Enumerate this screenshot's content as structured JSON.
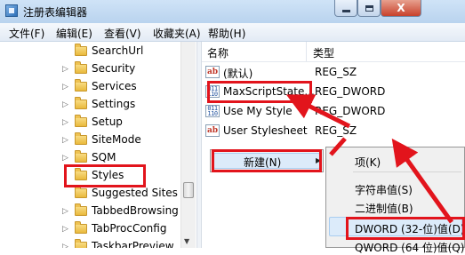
{
  "window": {
    "title": "注册表编辑器",
    "buttons": {
      "minimize": "minimize",
      "maximize": "maximize",
      "close": "X"
    }
  },
  "menu": {
    "file": "文件(F)",
    "edit": "编辑(E)",
    "view": "查看(V)",
    "favorites": "收藏夹(A)",
    "help": "帮助(H)"
  },
  "tree": {
    "items": [
      {
        "label": "SearchUrl",
        "has_children": false
      },
      {
        "label": "Security",
        "has_children": true
      },
      {
        "label": "Services",
        "has_children": true
      },
      {
        "label": "Settings",
        "has_children": true
      },
      {
        "label": "Setup",
        "has_children": true
      },
      {
        "label": "SiteMode",
        "has_children": true
      },
      {
        "label": "SQM",
        "has_children": true
      },
      {
        "label": "Styles",
        "has_children": false,
        "highlighted": true
      },
      {
        "label": "Suggested Sites",
        "has_children": false
      },
      {
        "label": "TabbedBrowsing",
        "has_children": true
      },
      {
        "label": "TabProcConfig",
        "has_children": true
      },
      {
        "label": "TaskbarPreview",
        "has_children": true
      }
    ],
    "expander_glyph": "▷"
  },
  "values": {
    "headers": {
      "name": "名称",
      "type": "类型"
    },
    "rows": [
      {
        "name": "(默认)",
        "type": "REG_SZ",
        "icon": "string-value-icon"
      },
      {
        "name": "MaxScriptState...",
        "type": "REG_DWORD",
        "icon": "dword-value-icon",
        "highlighted": true
      },
      {
        "name": "Use My Style",
        "type": "REG_DWORD",
        "icon": "dword-value-icon"
      },
      {
        "name": "User Stylesheet",
        "type": "REG_SZ",
        "icon": "string-value-icon"
      }
    ],
    "icon_text": {
      "sz": "ab",
      "dword": "011 110"
    }
  },
  "context_menu": {
    "new_label": "新建(N)",
    "arrow": "▶"
  },
  "submenu": {
    "items": [
      {
        "label": "项(K)"
      },
      {
        "label": "字符串值(S)"
      },
      {
        "label": "二进制值(B)"
      },
      {
        "label": "DWORD (32-位)值(D)",
        "highlighted": true
      },
      {
        "label": "QWORD (64 位)值(Q)"
      }
    ]
  },
  "annotations": {
    "highlight_color": "#e2141c"
  }
}
